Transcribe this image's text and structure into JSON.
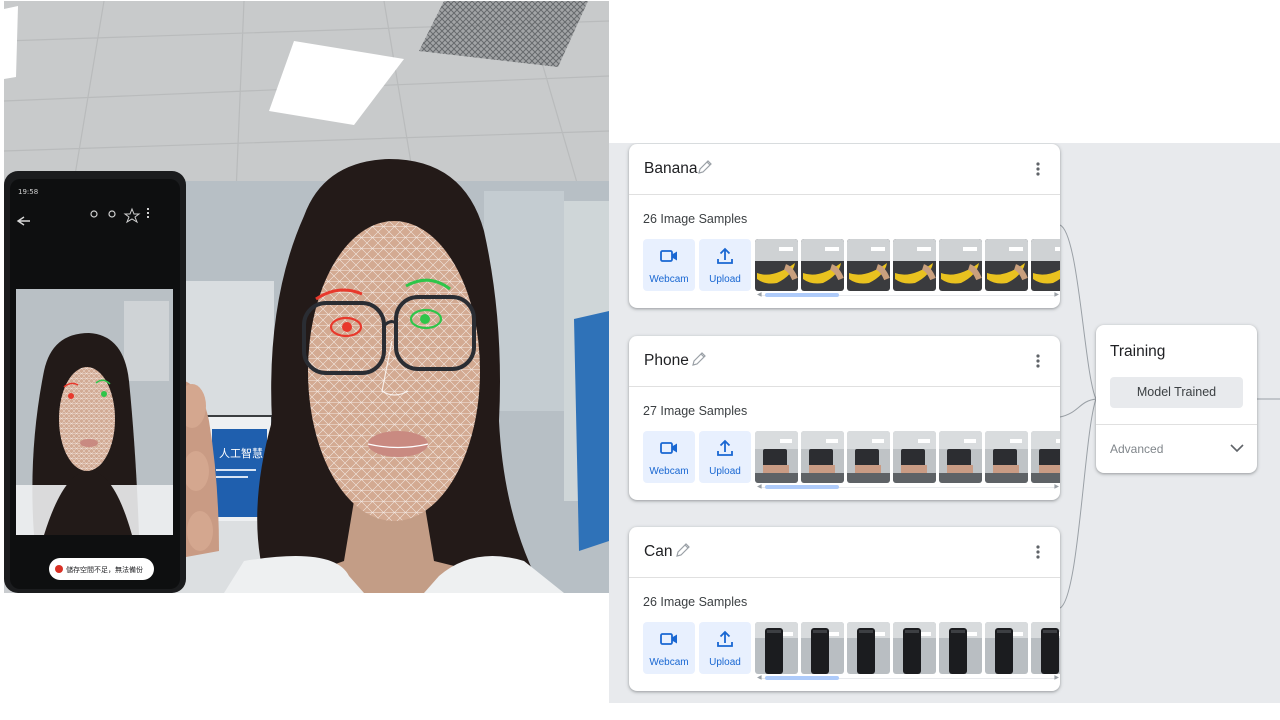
{
  "classes": [
    {
      "name": "Banana",
      "samples_label": "26 Image Samples",
      "thumb_color": "#e9c21f"
    },
    {
      "name": "Phone",
      "samples_label": "27 Image Samples",
      "thumb_color": "#2c2d31"
    },
    {
      "name": "Can",
      "samples_label": "26 Image Samples",
      "thumb_color": "#1b1c1f"
    }
  ],
  "buttons": {
    "webcam": "Webcam",
    "upload": "Upload"
  },
  "training": {
    "title": "Training",
    "button": "Model Trained",
    "advanced": "Advanced"
  },
  "phone_screen": {
    "status_time": "19:58",
    "toast": "儲存空間不足，無法備份"
  },
  "monitor_text": "人工智慧",
  "colors": {
    "accent": "#1967d2",
    "accent_bg": "#e8f0fe",
    "app_bg": "#e8eaed",
    "scroll_thumb": "#aecbfa",
    "eye_left": "#e8392c",
    "eye_right": "#2fc54a"
  },
  "icons": [
    "pencil-icon",
    "more-vert-icon",
    "videocam-icon",
    "upload-icon",
    "chevron-down-icon"
  ]
}
